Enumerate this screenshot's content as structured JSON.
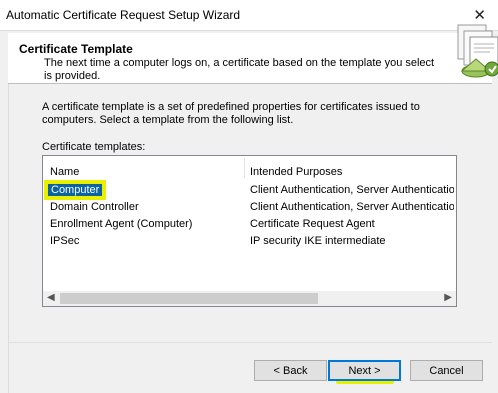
{
  "window": {
    "title": "Automatic Certificate Request Setup Wizard",
    "close_glyph": "✕"
  },
  "header": {
    "title": "Certificate Template",
    "description": "The next time a computer logs on, a certificate based on the template you select is provided.",
    "icon": "certificate-wizard-icon"
  },
  "body": {
    "intro": "A certificate template is a set of predefined properties for certificates issued to computers. Select a template from the following list.",
    "list_label": "Certificate templates:"
  },
  "table": {
    "columns": [
      "Name",
      "Intended Purposes"
    ],
    "rows": [
      {
        "name": "Computer",
        "purposes": "Client Authentication, Server Authentication",
        "selected": true
      },
      {
        "name": "Domain Controller",
        "purposes": "Client Authentication, Server Authentication",
        "selected": false
      },
      {
        "name": "Enrollment Agent (Computer)",
        "purposes": "Certificate Request Agent",
        "selected": false
      },
      {
        "name": "IPSec",
        "purposes": "IP security IKE intermediate",
        "selected": false
      }
    ]
  },
  "buttons": {
    "back": "< Back",
    "next": "Next >",
    "cancel": "Cancel"
  },
  "colors": {
    "highlight": "#e8f000",
    "selection": "#0a64a4",
    "focus": "#0078d7"
  }
}
